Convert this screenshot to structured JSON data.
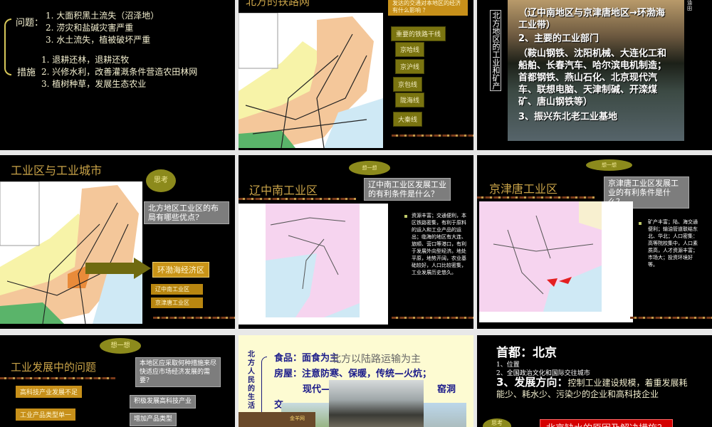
{
  "slides": [
    {
      "problem_label": "问题：",
      "problems": [
        "1. 大面积黑土流失（沼泽地）",
        "2. 涝灾和盐碱灾害严重",
        "3. 水土流失，植被破坏严重"
      ],
      "measure_label": "措施",
      "measures": [
        "1. 退耕还林，退耕还牧",
        "2. 兴修水利，改善灌溉条件营造农田林网",
        "3. 植树种草，发展生态农业"
      ]
    },
    {
      "title": "北方的铁路网",
      "question": "发达的交通对本地区的经济有什么影响 ？",
      "rail_header": "重要的铁路干线",
      "rails": [
        "京哈线",
        "京沪线",
        "京包线",
        "陇海线",
        "大秦线"
      ]
    },
    {
      "side_label": "北方地区的工业和矿产",
      "corner": "油田",
      "line1": "（辽中南地区与京津唐地区→环渤海工业带）",
      "line2": "2、主要的工业部门",
      "line3": "（鞍山钢铁、沈阳机械、大连化工和船舶、长春汽车、哈尔滨电机制造；首都钢铁、燕山石化、北京现代汽车、联想电脑、天津制碱、开滦煤矿、唐山钢铁等）",
      "line4": "3、振兴东北老工业基地"
    },
    {
      "title": "工业区与工业城市",
      "cloud": "思考",
      "question": "北方地区工业区的布局有哪些优点?",
      "zone": "环渤海经济区",
      "sub1": "辽中南工业区",
      "sub2": "京津唐工业区"
    },
    {
      "title": "辽中南工业区",
      "cloud": "想一想",
      "question": "辽中南工业区发展工业的有利条件是什么？",
      "answer": "资源丰富；交通便利，本区铁路密集，有利于原料的运入和工业产品的运出；临海的地区有大连、旅顺、营口等港口，有利于发展外向型经济。地处平原，地势开阔，农业基础较好，人口比较密集，工业发展历史悠久。"
    },
    {
      "title": "京津唐工业区",
      "cloud": "想一想",
      "question": "京津唐工业区发展工业的有利条件是什么？",
      "answer": "矿产丰富；陆、海交通便利；输油管道联结东北、华北；人口密集：高等院校集中，人口素质高，人才资源丰富；市场大；投资环境好等。"
    },
    {
      "title": "工业发展中的问题",
      "cloud": "想一想",
      "question": "本地区应采取何种措施来尽快适应市场经济发展的需要?",
      "problems": [
        "高科技产业发展不足",
        "工业产品类型单一"
      ],
      "solutions": [
        "积极发展高科技产业",
        "增加产品类型"
      ]
    },
    {
      "side_label": "北方人民的生活",
      "overlay": "北方以陆路运输为主",
      "food": "食品：面食为主",
      "house1": "房屋：注意防寒、保暖，传统—火炕；",
      "house2": "现代—",
      "house3": "窑洞",
      "traffic": "交",
      "badge": "金羊网"
    },
    {
      "title": "首都：北京",
      "item1": "1、位置",
      "item2": "2、全国政治文化和国际交往城市",
      "item3_label": "3、发展方向：",
      "item3_text": "控制工业建设规模，着重发展耗能少、耗水少、污染少的企业和高科技企业",
      "cloud": "思考",
      "question": "北京缺水的原因及解决措施？"
    }
  ]
}
